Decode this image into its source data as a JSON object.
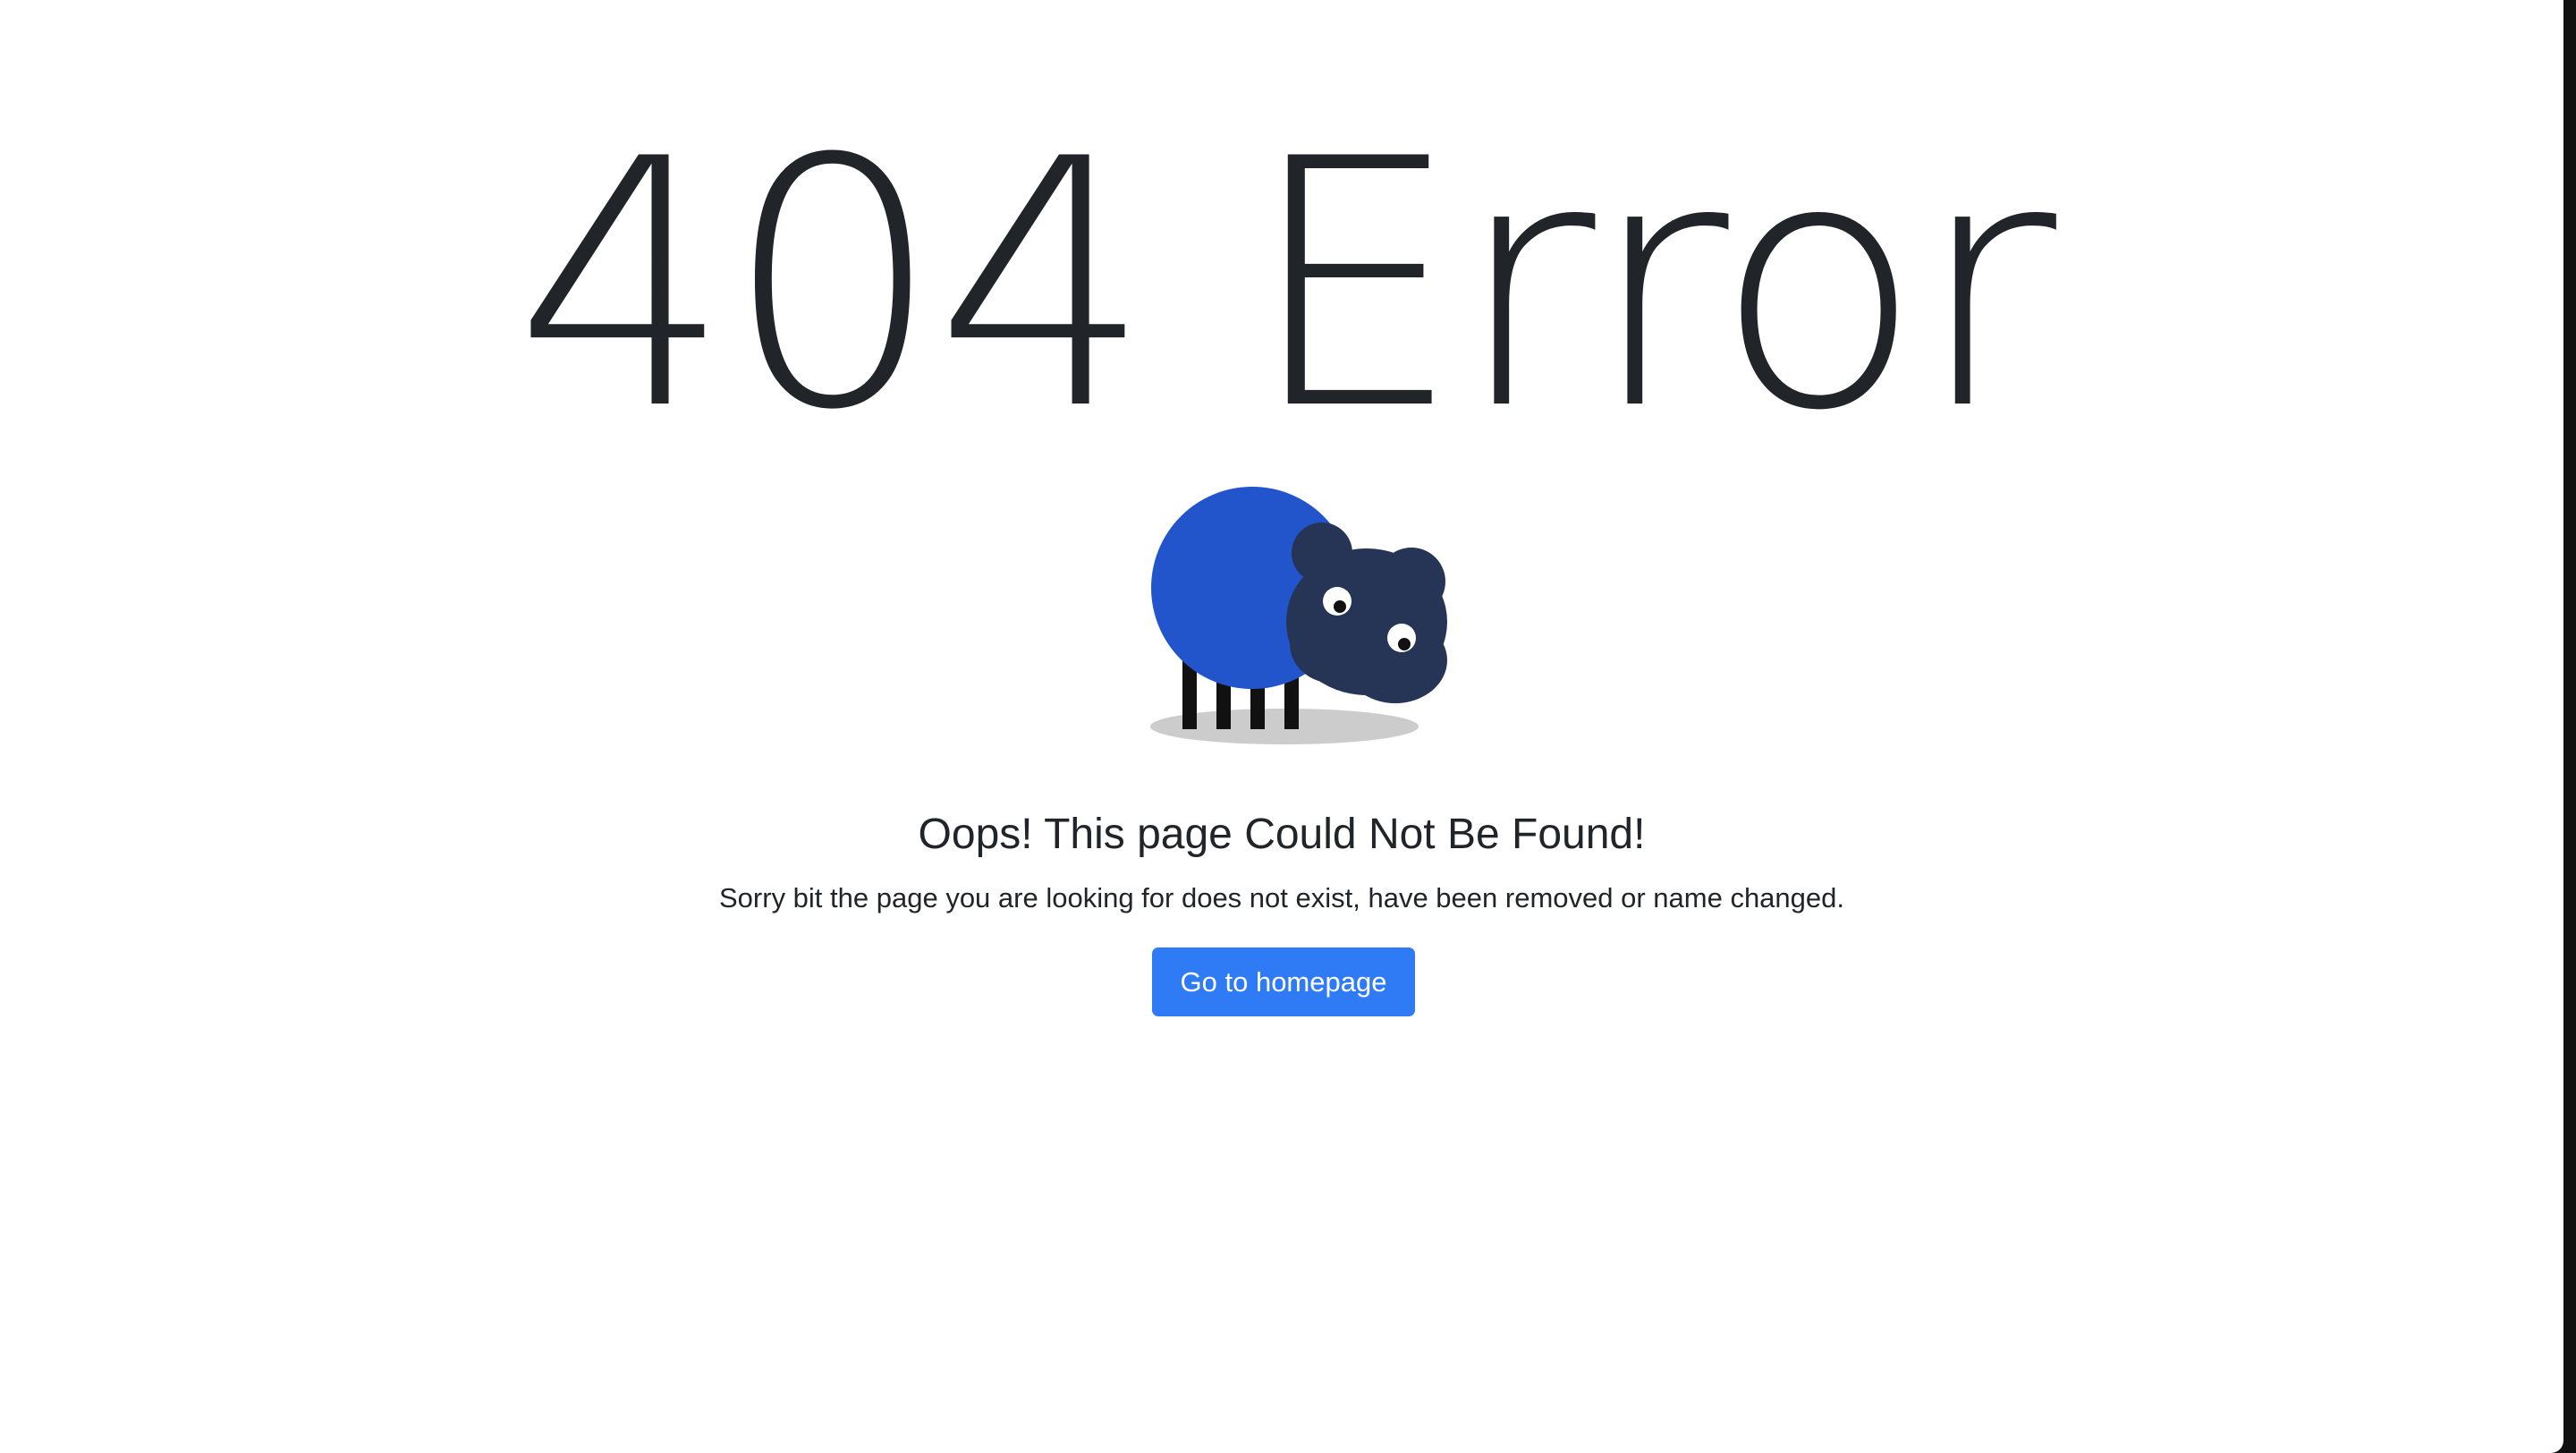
{
  "error": {
    "title": "404 Error",
    "heading": "Oops! This page Could Not Be Found!",
    "message": "Sorry bit the page you are looking for does not exist, have been removed or name changed.",
    "button_label": "Go to homepage"
  },
  "illustration": {
    "name": "sheep-illustration",
    "body_color": "#2255cc",
    "head_color": "#263455",
    "shadow_color": "#cccccc"
  },
  "colors": {
    "text": "#212529",
    "primary_button": "#2f7bf5",
    "background": "#ffffff"
  }
}
